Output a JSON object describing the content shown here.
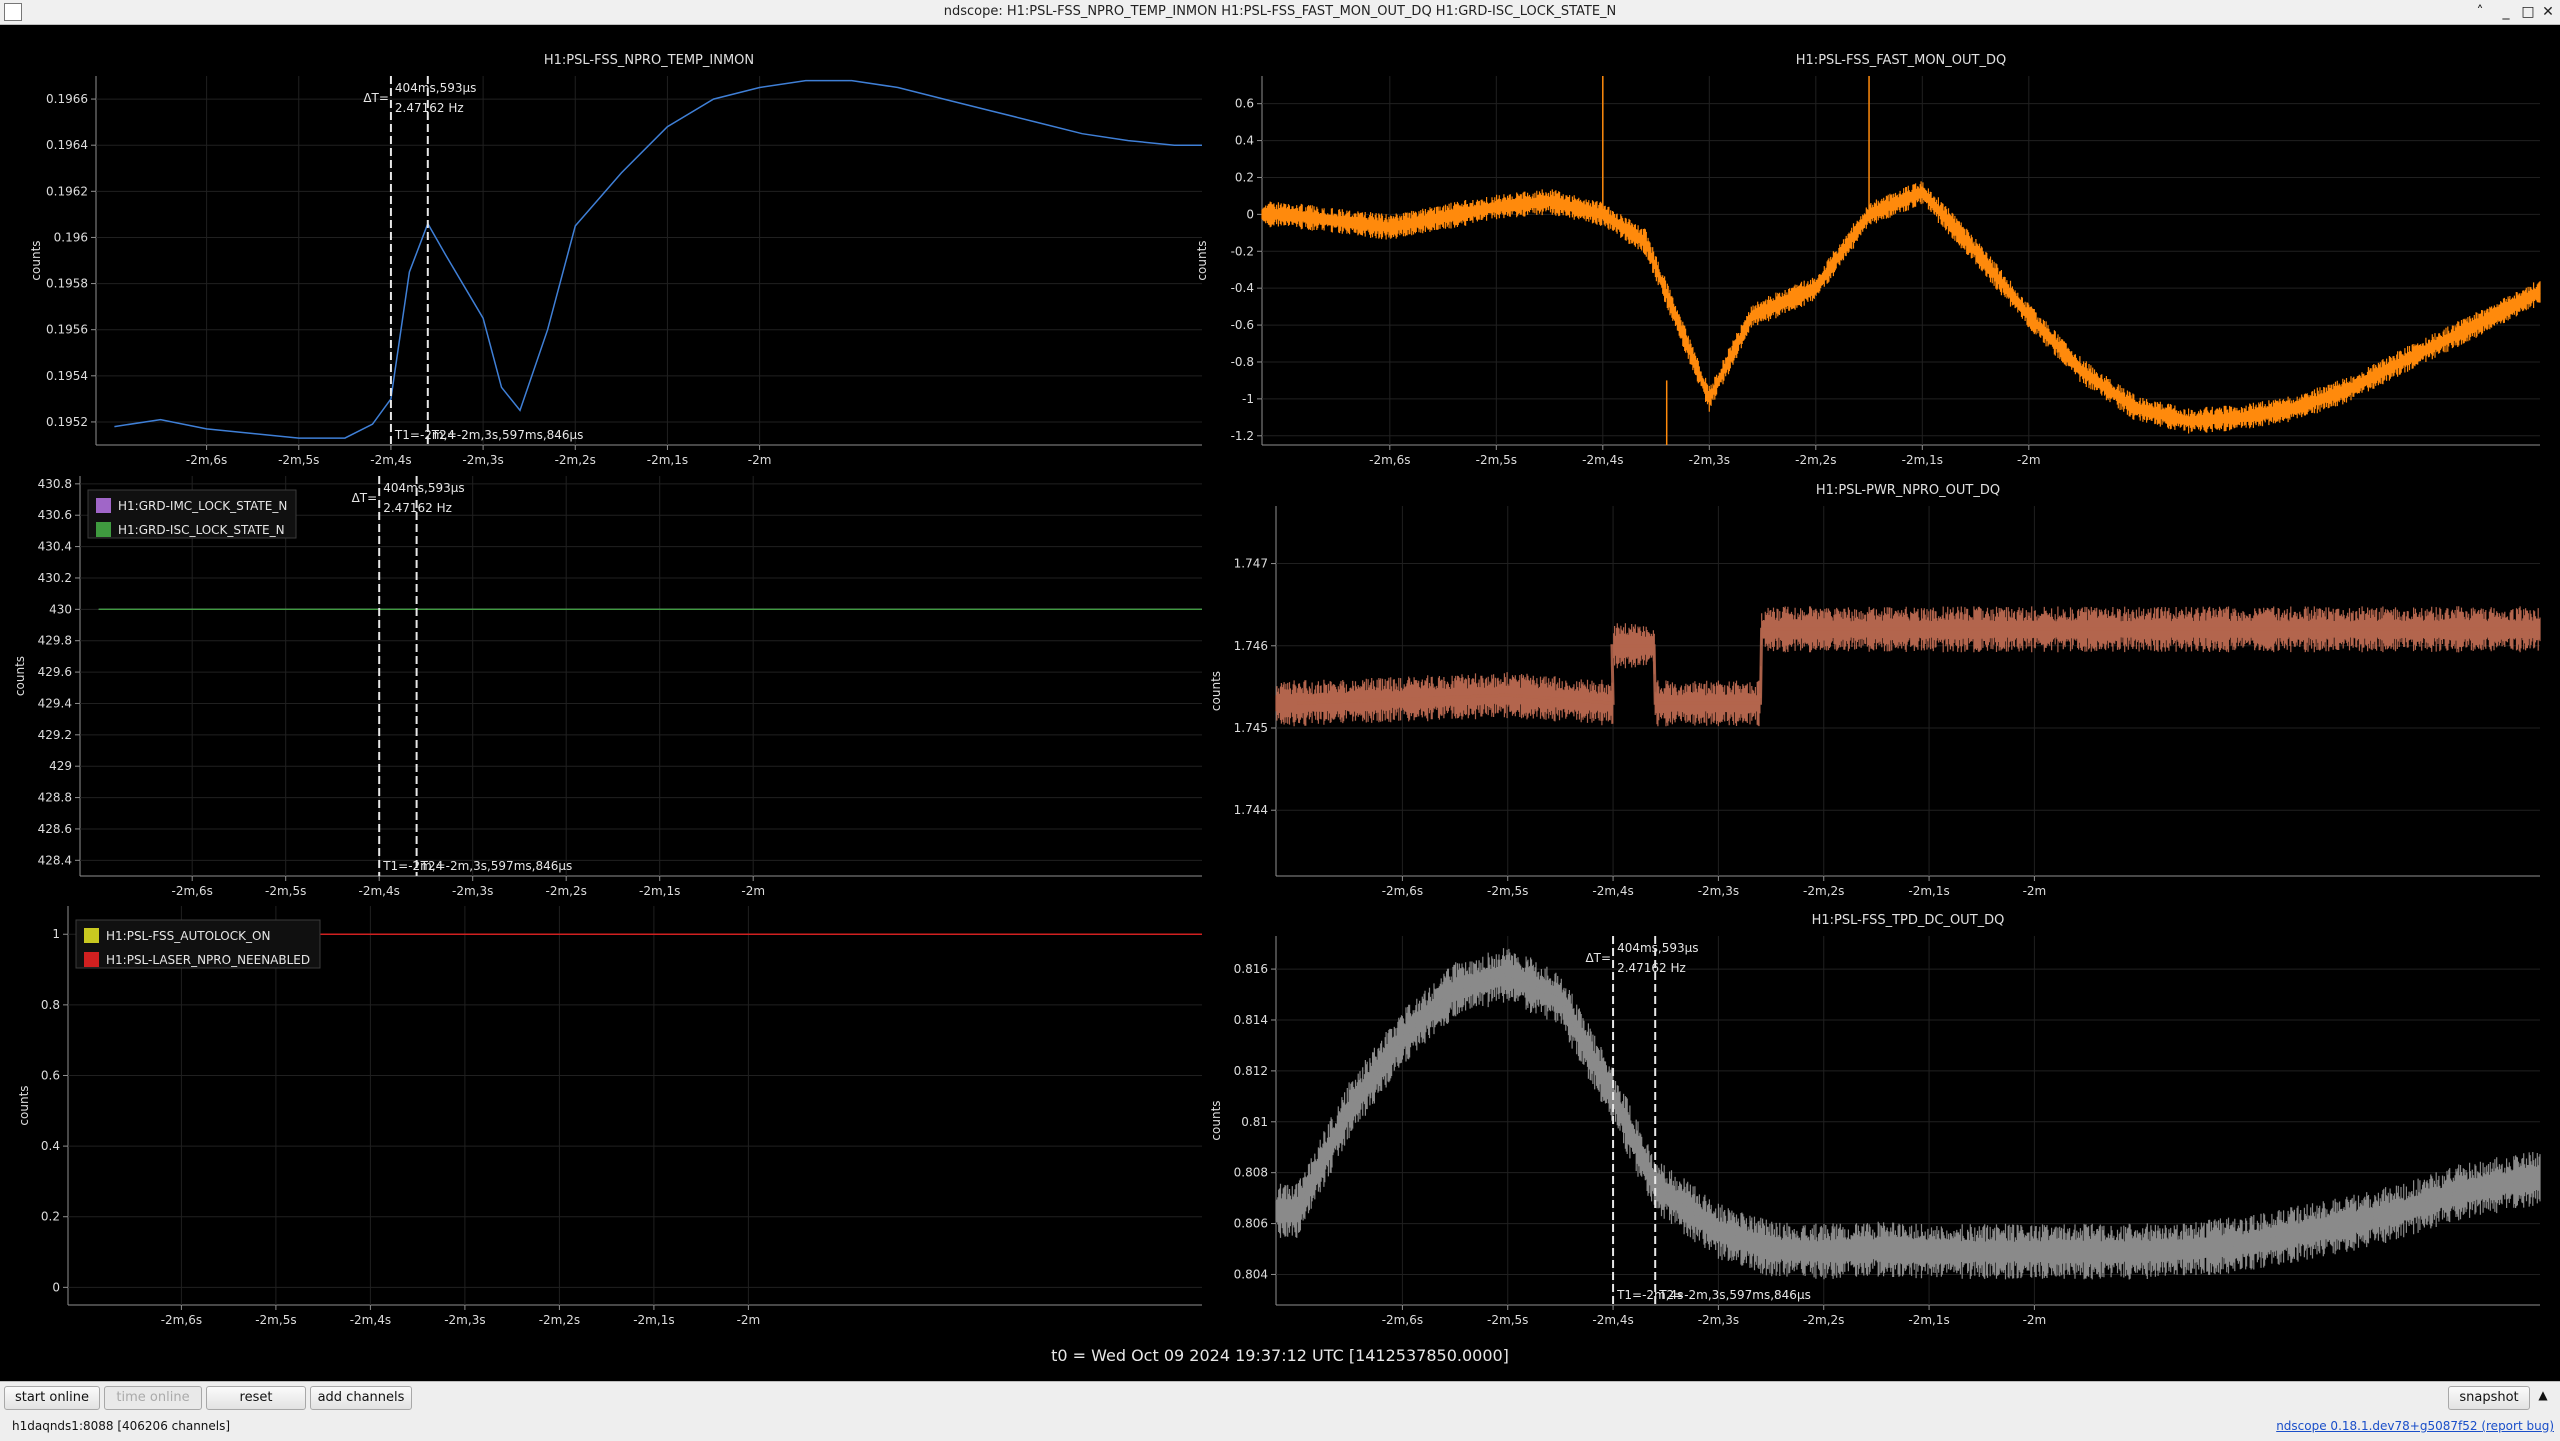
{
  "window": {
    "title": "ndscope: H1:PSL-FSS_NPRO_TEMP_INMON H1:PSL-FSS_FAST_MON_OUT_DQ H1:GRD-ISC_LOCK_STATE_N"
  },
  "colors": {
    "blue": "#3f7fd6",
    "orange": "#ff8a0c",
    "salmon": "#b3654d",
    "gray": "#8a8a8a",
    "green": "#3f9a3f",
    "red": "#d02020",
    "purple": "#a066c8",
    "yellow": "#c8c820"
  },
  "x_ticks": [
    "-2m,6s",
    "-2m,5s",
    "-2m,4s",
    "-2m,3s",
    "-2m,2s",
    "-2m,1s",
    "-2m"
  ],
  "y_label": "counts",
  "cursor": {
    "dt": "404ms,593µs",
    "freq": "2.47162 Hz",
    "dt_prefix": "ΔT=",
    "t1": "T1=-2m,4s",
    "t2": "T2=-2m,3s,597ms,846µs",
    "t1_short": "T1=-2m,4"
  },
  "panels": {
    "p1": {
      "title": "H1:PSL-FSS_NPRO_TEMP_INMON",
      "yticks": [
        "0.1952",
        "0.1954",
        "0.1956",
        "0.1958",
        "0.196",
        "0.1962",
        "0.1964",
        "0.1966"
      ]
    },
    "p2": {
      "title": "H1:PSL-FSS_FAST_MON_OUT_DQ",
      "yticks": [
        "-1.2",
        "-1",
        "-0.8",
        "-0.6",
        "-0.4",
        "-0.2",
        "0",
        "0.2",
        "0.4",
        "0.6"
      ]
    },
    "p3": {
      "title": "",
      "yticks": [
        "428.4",
        "428.6",
        "428.8",
        "429",
        "429.2",
        "429.4",
        "429.6",
        "429.8",
        "430",
        "430.2",
        "430.4",
        "430.6",
        "430.8"
      ],
      "legend": [
        "H1:GRD-IMC_LOCK_STATE_N",
        "H1:GRD-ISC_LOCK_STATE_N"
      ]
    },
    "p4": {
      "title": "H1:PSL-PWR_NPRO_OUT_DQ",
      "yticks": [
        "1.744",
        "1.745",
        "1.746",
        "1.747"
      ]
    },
    "p5": {
      "title": "",
      "yticks": [
        "0",
        "0.2",
        "0.4",
        "0.6",
        "0.8",
        "1"
      ],
      "legend": [
        "H1:PSL-FSS_AUTOLOCK_ON",
        "H1:PSL-LASER_NPRO_NEENABLED"
      ]
    },
    "p6": {
      "title": "H1:PSL-FSS_TPD_DC_OUT_DQ",
      "yticks": [
        "0.804",
        "0.806",
        "0.808",
        "0.81",
        "0.812",
        "0.814",
        "0.816"
      ]
    }
  },
  "chart_data": [
    {
      "type": "line",
      "title": "H1:PSL-FSS_NPRO_TEMP_INMON",
      "ylabel": "counts",
      "ylim": [
        0.1951,
        0.1967
      ],
      "x": [
        -127.0,
        -126.5,
        -126.0,
        -125.5,
        -125.0,
        -124.5,
        -124.2,
        -124.0,
        -123.8,
        -123.6,
        -123.4,
        -123.0,
        -122.8,
        -122.6,
        -122.3,
        -122.0,
        -121.5,
        -121.0,
        -120.5,
        -120.0,
        -119.5,
        -119.0,
        -118.5,
        -118.0,
        -117.5,
        -117.0,
        -116.5,
        -116.0,
        -115.5,
        -115.2
      ],
      "y": [
        0.19518,
        0.19521,
        0.19517,
        0.19515,
        0.19513,
        0.19513,
        0.19519,
        0.1953,
        0.19585,
        0.19606,
        0.19592,
        0.19565,
        0.19535,
        0.19525,
        0.1956,
        0.19605,
        0.19628,
        0.19648,
        0.1966,
        0.19665,
        0.19668,
        0.19668,
        0.19665,
        0.1966,
        0.19655,
        0.1965,
        0.19645,
        0.19642,
        0.1964,
        0.1964
      ]
    },
    {
      "type": "line",
      "title": "H1:PSL-FSS_FAST_MON_OUT_DQ",
      "ylabel": "counts",
      "ylim": [
        -1.25,
        0.75
      ],
      "x": [
        -127.0,
        -126.0,
        -125.0,
        -124.5,
        -124.0,
        -123.6,
        -123.0,
        -122.6,
        -122.0,
        -121.5,
        -121.0,
        -120.5,
        -120.0,
        -119.5,
        -119.0,
        -118.5,
        -118.0,
        -117.5,
        -117.0,
        -116.5,
        -115.8,
        -115.2
      ],
      "y": [
        0.0,
        -0.07,
        0.04,
        0.07,
        0.0,
        -0.15,
        -1.0,
        -0.55,
        -0.4,
        0.0,
        0.12,
        -0.2,
        -0.55,
        -0.85,
        -1.05,
        -1.12,
        -1.1,
        -1.05,
        -0.95,
        -0.8,
        -0.6,
        -0.42
      ]
    },
    {
      "type": "line",
      "title": "",
      "ylabel": "counts",
      "ylim": [
        428.3,
        430.85
      ],
      "series": [
        {
          "name": "H1:GRD-IMC_LOCK_STATE_N",
          "x": [
            -127.0,
            -115.2
          ],
          "y": [
            430,
            430
          ]
        },
        {
          "name": "H1:GRD-ISC_LOCK_STATE_N",
          "x": [
            -127.0,
            -115.2
          ],
          "y": [
            430,
            430
          ]
        }
      ]
    },
    {
      "type": "line",
      "title": "H1:PSL-PWR_NPRO_OUT_DQ",
      "ylabel": "counts",
      "ylim": [
        1.7432,
        1.7477
      ],
      "x": [
        -127.0,
        -125.0,
        -124.0,
        -124.01,
        -123.61,
        -123.6,
        -122.6,
        -122.59,
        -115.2
      ],
      "y": [
        1.7453,
        1.7454,
        1.7453,
        1.746,
        1.746,
        1.7453,
        1.7453,
        1.7462,
        1.7462
      ]
    },
    {
      "type": "line",
      "title": "",
      "ylabel": "counts",
      "ylim": [
        -0.05,
        1.08
      ],
      "series": [
        {
          "name": "H1:PSL-FSS_AUTOLOCK_ON",
          "x": [
            -127.0,
            -115.2
          ],
          "y": [
            1,
            1
          ]
        },
        {
          "name": "H1:PSL-LASER_NPRO_NEENABLED",
          "x": [
            -127.0,
            -115.2
          ],
          "y": [
            1,
            1
          ]
        }
      ]
    },
    {
      "type": "line",
      "title": "H1:PSL-FSS_TPD_DC_OUT_DQ",
      "ylabel": "counts",
      "ylim": [
        0.8028,
        0.8173
      ],
      "x": [
        -127.0,
        -126.5,
        -126.0,
        -125.5,
        -125.0,
        -124.5,
        -124.0,
        -123.6,
        -123.0,
        -122.5,
        -122.0,
        -121.5,
        -121.0,
        -120.5,
        -120.0,
        -119.5,
        -119.0,
        -118.5,
        -118.0,
        -117.5,
        -117.0,
        -116.5,
        -116.0,
        -115.5,
        -115.2
      ],
      "y": [
        0.8065,
        0.8105,
        0.8133,
        0.8152,
        0.8158,
        0.8148,
        0.811,
        0.8075,
        0.8057,
        0.805,
        0.8049,
        0.805,
        0.8049,
        0.8049,
        0.8049,
        0.8049,
        0.8049,
        0.805,
        0.8052,
        0.8056,
        0.806,
        0.8065,
        0.8072,
        0.8076,
        0.8078
      ]
    }
  ],
  "footer": {
    "t0": "t0 = Wed Oct 09 2024 19:37:12 UTC [1412537850.0000]"
  },
  "toolbar": {
    "start_online": "start online",
    "time_online": "time online",
    "reset": "reset",
    "add_channels": "add channels",
    "snapshot": "snapshot"
  },
  "status": {
    "server": "h1daqnds1:8088  [406206 channels]",
    "version": "ndscope 0.18.1.dev78+g5087f52",
    "report": "(report bug)"
  }
}
